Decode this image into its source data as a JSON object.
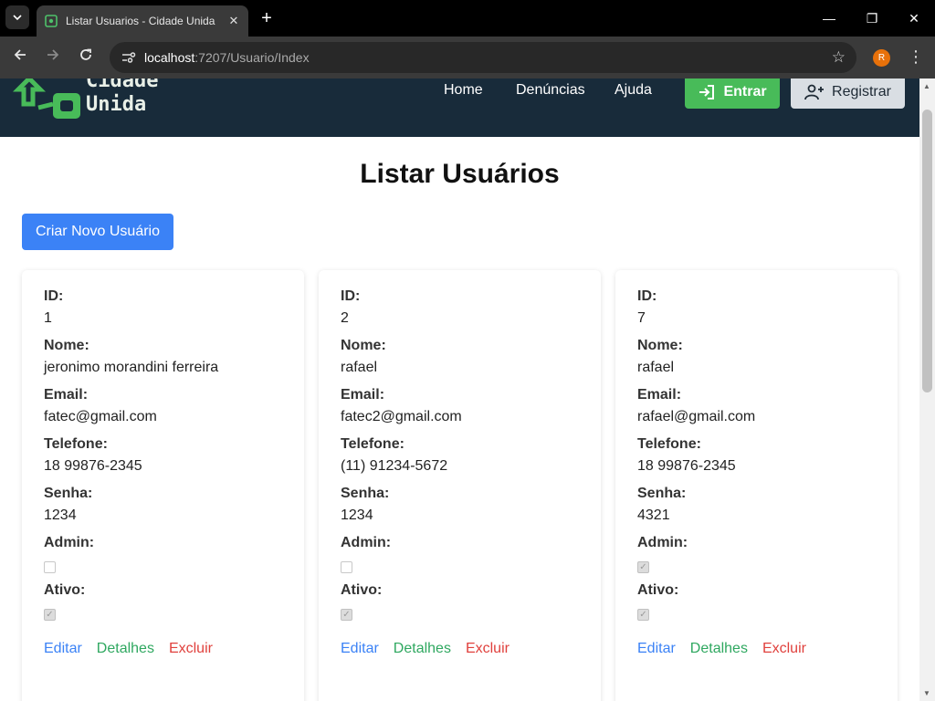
{
  "browser": {
    "tab_title": "Listar Usuarios - Cidade Unida",
    "url_host": "localhost",
    "url_path": ":7207/Usuario/Index",
    "profile_initial": "R"
  },
  "site": {
    "logo_line1": "Cidade",
    "logo_line2": "Unida",
    "nav": [
      "Home",
      "Denúncias",
      "Ajuda"
    ],
    "login_label": "Entrar",
    "register_label": "Registrar"
  },
  "page": {
    "title": "Listar Usuários",
    "create_label": "Criar Novo Usuário",
    "labels": {
      "id": "ID:",
      "nome": "Nome:",
      "email": "Email:",
      "telefone": "Telefone:",
      "senha": "Senha:",
      "admin": "Admin:",
      "ativo": "Ativo:"
    },
    "actions": {
      "edit": "Editar",
      "details": "Detalhes",
      "delete": "Excluir"
    }
  },
  "users": [
    {
      "id": "1",
      "nome": "jeronimo morandini ferreira",
      "email": "fatec@gmail.com",
      "telefone": "18 99876-2345",
      "senha": "1234",
      "admin": false,
      "ativo": true
    },
    {
      "id": "2",
      "nome": "rafael",
      "email": "fatec2@gmail.com",
      "telefone": "(11) 91234-5672",
      "senha": "1234",
      "admin": false,
      "ativo": true
    },
    {
      "id": "7",
      "nome": "rafael",
      "email": "rafael@gmail.com",
      "telefone": "18 99876-2345",
      "senha": "4321",
      "admin": true,
      "ativo": true
    }
  ],
  "colors": {
    "header_bg": "#182b3a",
    "login_green": "#48bb59",
    "primary_blue": "#3b82f6",
    "details_green": "#2fa860",
    "delete_red": "#e0413d"
  }
}
